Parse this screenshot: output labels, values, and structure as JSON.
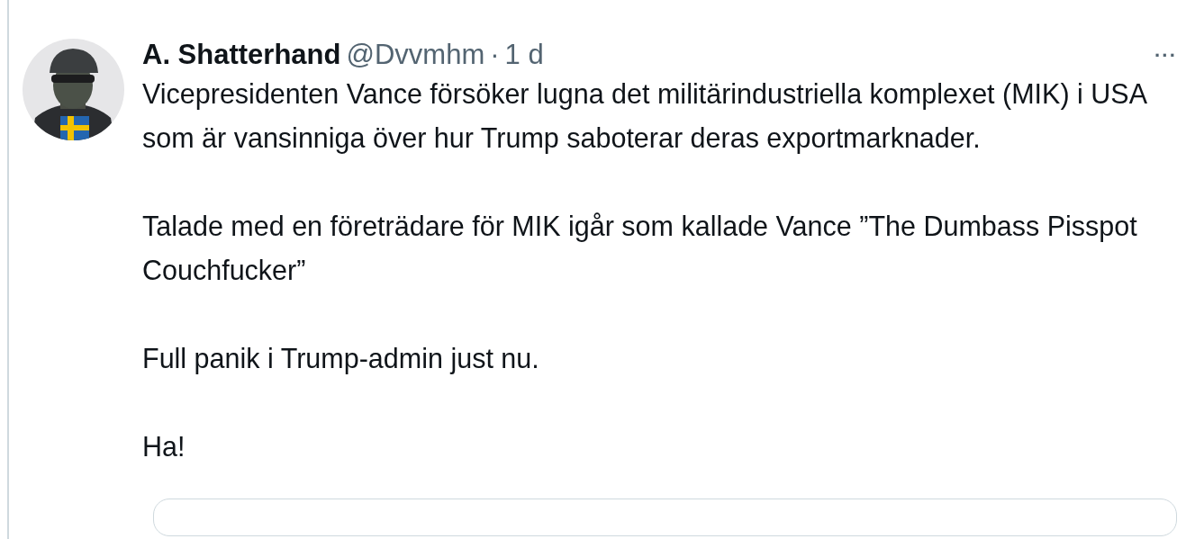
{
  "tweet": {
    "author_name": "A. Shatterhand",
    "handle": "@Dvvmhm",
    "separator": "·",
    "time": "1 d",
    "more": "···",
    "paragraphs": [
      "Vicepresidenten Vance försöker lugna det militärindustriella komplexet (MIK) i USA som är vansinniga över hur Trump saboterar deras exportmarknader.",
      "Talade med en företrädare för MIK igår som kallade Vance ”The Dumbass Pisspot Couchfucker”",
      "Full panik i Trump-admin just nu.",
      "Ha!"
    ],
    "embedded_card": {
      "kind": "card"
    }
  }
}
